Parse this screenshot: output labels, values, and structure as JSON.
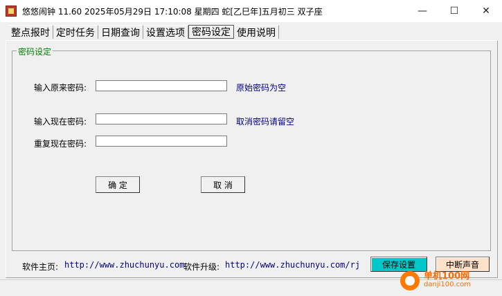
{
  "window": {
    "title": "悠悠闹钟 11.60 2025年05月29日 17:10:08 星期四 蛇[乙巳年]五月初三 双子座",
    "minimize_glyph": "—",
    "maximize_glyph": "☐",
    "close_glyph": "✕"
  },
  "tabs": [
    {
      "label": "整点报时"
    },
    {
      "label": "定时任务"
    },
    {
      "label": "日期查询"
    },
    {
      "label": "设置选项"
    },
    {
      "label": "密码设定"
    },
    {
      "label": "使用说明"
    }
  ],
  "active_tab": "密码设定",
  "group": {
    "title": "密码设定"
  },
  "form": {
    "old_password_label": "输入原来密码:",
    "old_password_hint": "原始密码为空",
    "new_password_label": "输入现在密码:",
    "new_password_hint": "取消密码请留空",
    "repeat_password_label": "重复现在密码:",
    "old_password_value": "",
    "new_password_value": "",
    "repeat_password_value": ""
  },
  "buttons": {
    "ok": "确 定",
    "cancel": "取 消",
    "save": "保存设置",
    "stop_sound": "中断声音"
  },
  "footer": {
    "homepage_label": "软件主页:",
    "homepage_url": "http://www.zhuchunyu.com",
    "upgrade_label": "软件升级:",
    "upgrade_url": "http://www.zhuchunyu.com/rj"
  },
  "watermark": {
    "line1": "单机100网",
    "line2": "danji100.com"
  },
  "colors": {
    "save_button_bg": "#00c8c8",
    "stop_button_bg": "#ffe0c8",
    "group_title": "#008000",
    "hint_text": "#000080"
  }
}
